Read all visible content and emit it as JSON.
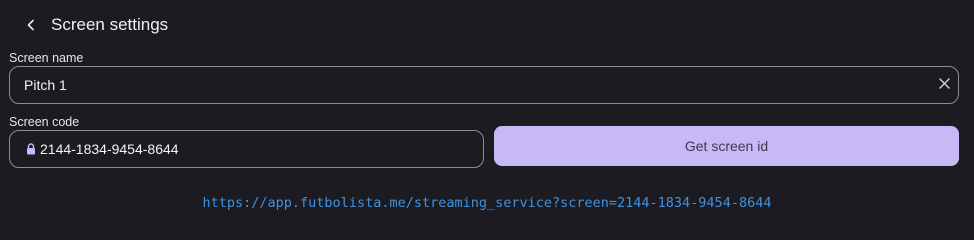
{
  "header": {
    "back_icon": "chevron-left-icon",
    "title": "Screen settings"
  },
  "screen_name": {
    "label": "Screen name",
    "value": "Pitch 1",
    "clear_icon": "close-icon"
  },
  "screen_code": {
    "label": "Screen code",
    "value": "2144-1834-9454-8644",
    "lock_icon": "lock-icon"
  },
  "actions": {
    "get_screen_id_label": "Get screen id"
  },
  "stream_link": {
    "text": "https://app.futbolista.me/streaming_service?screen=2144-1834-9454-8644"
  },
  "colors": {
    "background": "#1c1b21",
    "accent_button": "#c8b8f5",
    "link": "#3f92e0",
    "lock_icon": "#c8b8f5",
    "border": "#8d8b95"
  }
}
